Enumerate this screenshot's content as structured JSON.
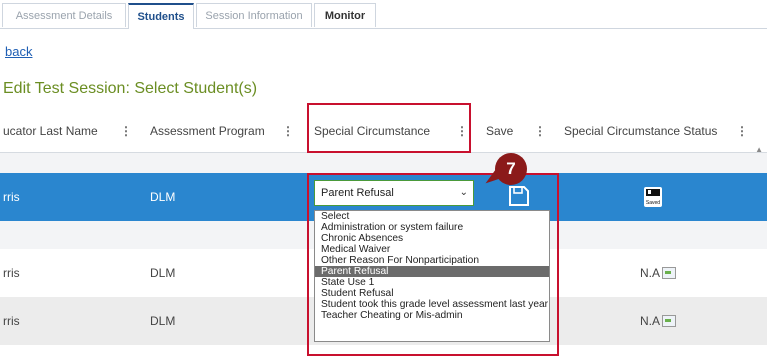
{
  "tabs": [
    {
      "label": "Assessment Details"
    },
    {
      "label": "Students"
    },
    {
      "label": "Session Information"
    },
    {
      "label": "Monitor"
    }
  ],
  "nav": {
    "back_label": "back"
  },
  "page": {
    "title": "Edit Test Session: Select Student(s)"
  },
  "table": {
    "columns": [
      {
        "label": "ucator Last Name"
      },
      {
        "label": "Assessment Program"
      },
      {
        "label": "Special Circumstance"
      },
      {
        "label": "Save"
      },
      {
        "label": "Special Circumstance Status"
      }
    ],
    "menu_glyph": "⋮",
    "rows": [
      {
        "last_name": "rris",
        "program": "DLM",
        "selected_value": "Parent Refusal",
        "status_icon_label": "Saved"
      },
      {
        "last_name": "rris",
        "program": "DLM",
        "status": "N.A"
      },
      {
        "last_name": "rris",
        "program": "DLM",
        "status": "N.A"
      }
    ]
  },
  "dropdown": {
    "options": [
      "Select",
      "Administration or system failure",
      "Chronic Absences",
      "Medical Waiver",
      "Other Reason For Nonparticipation",
      "Parent Refusal",
      "State Use 1",
      "Student Refusal",
      "Student took this grade level assessment last year",
      "Teacher Cheating or Mis-admin"
    ],
    "highlighted": "Parent Refusal"
  },
  "callout": {
    "step_number": "7"
  },
  "colors": {
    "selected_row": "#2a86cf",
    "accent_red": "#c8102e",
    "title_green": "#6b8e23",
    "badge": "#8b1a1a"
  }
}
